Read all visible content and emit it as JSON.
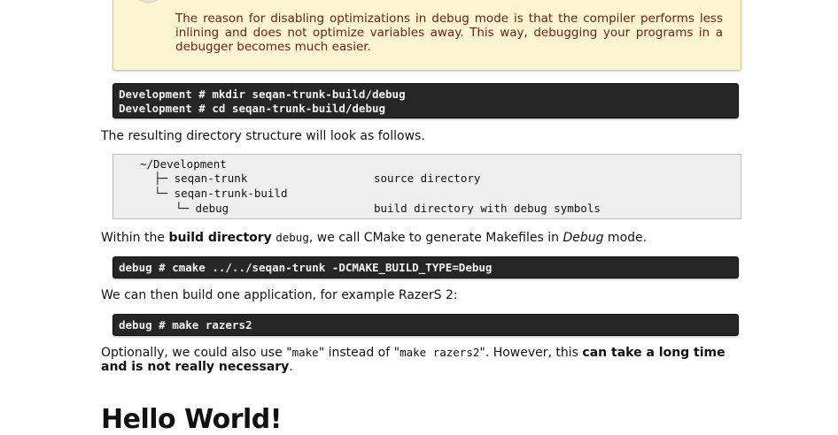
{
  "note": {
    "text": "The reason for disabling optimizations in debug mode is that the compiler performs less inlining and does not optimize variables away. This way, debugging your programs in a debugger becomes much easier."
  },
  "block1": {
    "line1": "Development # mkdir seqan-trunk-build/debug",
    "line2": "Development # cd seqan-trunk-build/debug"
  },
  "para1": "The resulting directory structure will look as follows.",
  "tree": {
    "root": "~/Development",
    "r1_name": "├─ seqan-trunk",
    "r1_desc": "source directory",
    "r2_name": "└─ seqan-trunk-build",
    "r3_name": "└─ debug",
    "r3_desc": "build directory with debug symbols"
  },
  "para2": {
    "t1": "Within the ",
    "b1": "build directory",
    "t2": " ",
    "c1": "debug",
    "t3": ", we call CMake to generate Makefiles in ",
    "i1": "Debug",
    "t4": " mode."
  },
  "block2": {
    "line1": "debug # cmake ../../seqan-trunk -DCMAKE_BUILD_TYPE=Debug"
  },
  "para3": "We can then build one application, for example RazerS 2:",
  "block3": {
    "line1": "debug # make razers2"
  },
  "para4": {
    "t1": "Optionally, we could also use \"",
    "c1": "make",
    "t2": "\" instead of \"",
    "c2": "make razers2",
    "t3": "\". However, this ",
    "b1": "can take a long time and is not really necessary",
    "t4": "."
  },
  "heading": "Hello World!"
}
